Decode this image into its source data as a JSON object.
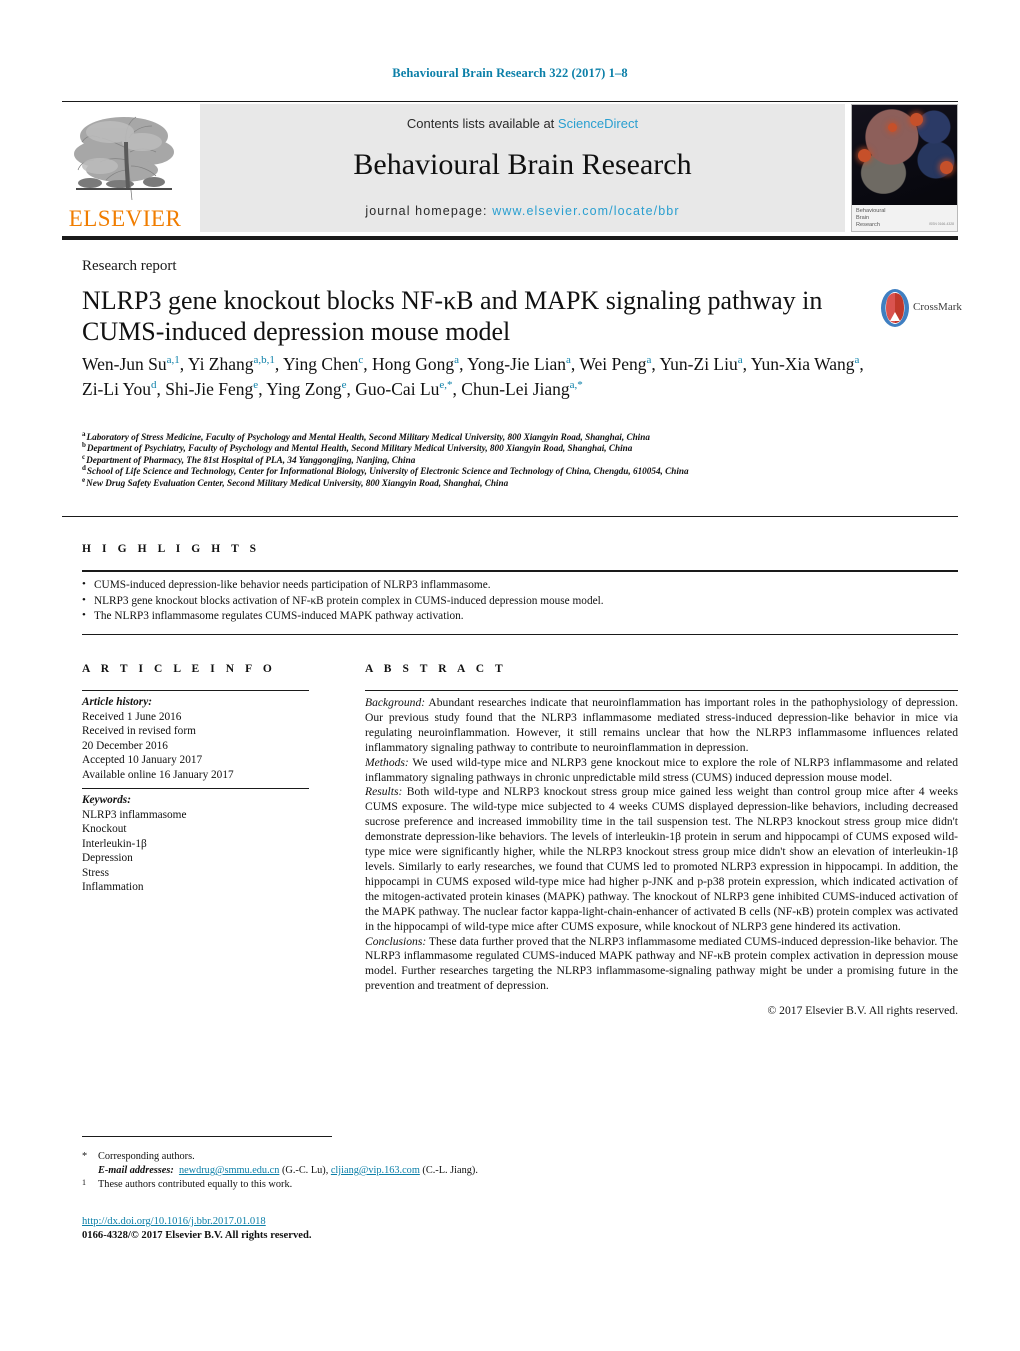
{
  "running_head": "Behavioural Brain Research 322 (2017) 1–8",
  "masthead": {
    "publisher_logo_text": "ELSEVIER",
    "contents_prefix": "Contents lists available at ",
    "contents_link": "ScienceDirect",
    "journal_title": "Behavioural Brain Research",
    "homepage_prefix": "journal homepage: ",
    "homepage_url": "www.elsevier.com/locate/bbr",
    "cover_caption_line1": "Behavioural",
    "cover_caption_line2": "Brain",
    "cover_caption_line3": "Research",
    "cover_issn": "ISSN 0166-4328"
  },
  "article": {
    "type": "Research report",
    "title_line1": "NLRP3 gene knockout blocks NF-κB and MAPK signaling pathway in",
    "title_line2": "CUMS-induced depression mouse model",
    "crossmark_label": "CrossMark"
  },
  "authors": [
    {
      "name": "Wen-Jun Su",
      "sup": "a,1",
      "sep": ", "
    },
    {
      "name": "Yi Zhang",
      "sup": "a,b,1",
      "sep": ", "
    },
    {
      "name": "Ying Chen",
      "sup": "c",
      "sep": ", "
    },
    {
      "name": "Hong Gong",
      "sup": "a",
      "sep": ", "
    },
    {
      "name": "Yong-Jie Lian",
      "sup": "a",
      "sep": ", "
    },
    {
      "name": "Wei Peng",
      "sup": "a",
      "sep": ", "
    },
    {
      "name": "Yun-Zi Liu",
      "sup": "a",
      "sep": ", "
    },
    {
      "name": "Yun-Xia Wang",
      "sup": "a",
      "sep": ", "
    },
    {
      "name": "Zi-Li You",
      "sup": "d",
      "sep": ", "
    },
    {
      "name": "Shi-Jie Feng",
      "sup": "e",
      "sep": ", "
    },
    {
      "name": "Ying Zong",
      "sup": "e",
      "sep": ", "
    },
    {
      "name": "Guo-Cai Lu",
      "sup": "e,*",
      "sep": ", "
    },
    {
      "name": "Chun-Lei Jiang",
      "sup": "a,*",
      "sep": ""
    }
  ],
  "affiliations": [
    {
      "marker": "a",
      "text": "Laboratory of Stress Medicine, Faculty of Psychology and Mental Health, Second Military Medical University, 800 Xiangyin Road, Shanghai, China"
    },
    {
      "marker": "b",
      "text": "Department of Psychiatry, Faculty of Psychology and Mental Health, Second Military Medical University, 800 Xiangyin Road, Shanghai, China"
    },
    {
      "marker": "c",
      "text": "Department of Pharmacy, The 81st Hospital of PLA, 34 Yanggongjing, Nanjing, China"
    },
    {
      "marker": "d",
      "text": "School of Life Science and Technology, Center for Informational Biology, University of Electronic Science and Technology of China, Chengdu, 610054, China"
    },
    {
      "marker": "e",
      "text": "New Drug Safety Evaluation Center, Second Military Medical University, 800 Xiangyin Road, Shanghai, China"
    }
  ],
  "highlights": {
    "label": "H I G H L I G H T S",
    "items": [
      "CUMS-induced depression-like behavior needs participation of NLRP3 inflammasome.",
      "NLRP3 gene knockout blocks activation of NF-κB protein complex in CUMS-induced depression mouse model.",
      "The NLRP3 inflammasome regulates CUMS-induced MAPK pathway activation."
    ]
  },
  "article_info": {
    "label": "A R T I C L E  I N F O",
    "history_heading": "Article history:",
    "history_lines": [
      "Received 1 June 2016",
      "Received in revised form",
      "20 December 2016",
      "Accepted 10 January 2017",
      "Available online 16 January 2017"
    ],
    "keywords_heading": "Keywords:",
    "keywords": [
      "NLRP3 inflammasome",
      "Knockout",
      "Interleukin-1β",
      "Depression",
      "Stress",
      "Inflammation"
    ]
  },
  "abstract": {
    "label": "A B S T R A C T",
    "background_lead": "Background:",
    "background_text": " Abundant researches indicate that neuroinflammation has important roles in the pathophysiology of depression. Our previous study found that the NLRP3 inflammasome mediated stress-induced depression-like behavior in mice via regulating neuroinflammation. However, it still remains unclear that how the NLRP3 inflammasome influences related inflammatory signaling pathway to contribute to neuroinflammation in depression.",
    "methods_lead": "Methods:",
    "methods_text": " We used wild-type mice and NLRP3 gene knockout mice to explore the role of NLRP3 inflammasome and related inflammatory signaling pathways in chronic unpredictable mild stress (CUMS) induced depression mouse model.",
    "results_lead": "Results:",
    "results_text": " Both wild-type and NLRP3 knockout stress group mice gained less weight than control group mice after 4 weeks CUMS exposure. The wild-type mice subjected to 4 weeks CUMS displayed depression-like behaviors, including decreased sucrose preference and increased immobility time in the tail suspension test. The NLRP3 knockout stress group mice didn't demonstrate depression-like behaviors. The levels of interleukin-1β protein in serum and hippocampi of CUMS exposed wild-type mice were significantly higher, while the NLRP3 knockout stress group mice didn't show an elevation of interleukin-1β levels. Similarly to early researches, we found that CUMS led to promoted NLRP3 expression in hippocampi. In addition, the hippocampi in CUMS exposed wild-type mice had higher p-JNK and p-p38 protein expression, which indicated activation of the mitogen-activated protein kinases (MAPK) pathway. The knockout of NLRP3 gene inhibited CUMS-induced activation of the MAPK pathway. The nuclear factor kappa-light-chain-enhancer of activated B cells (NF-κB) protein complex was activated in the hippocampi of wild-type mice after CUMS exposure, while knockout of NLRP3 gene hindered its activation.",
    "conclusions_lead": "Conclusions:",
    "conclusions_text": " These data further proved that the NLRP3 inflammasome mediated CUMS-induced depression-like behavior. The NLRP3 inflammasome regulated CUMS-induced MAPK pathway and NF-κB protein complex activation in depression mouse model. Further researches targeting the NLRP3 inflammasome-signaling pathway might be under a promising future in the prevention and treatment of depression.",
    "copyright": "© 2017 Elsevier B.V. All rights reserved."
  },
  "footnotes": {
    "corresponding_marker": "*",
    "corresponding_text": "Corresponding authors.",
    "email_label": "E-mail addresses:",
    "email_1": "newdrug@smmu.edu.cn",
    "email_1_attr": " (G.-C. Lu), ",
    "email_2": "cljiang@vip.163.com",
    "email_2_attr": " (C.-L. Jiang).",
    "equal_marker": "1",
    "equal_text": "These authors contributed equally to this work."
  },
  "footer": {
    "doi": "http://dx.doi.org/10.1016/j.bbr.2017.01.018",
    "issn_line": "0166-4328/© 2017 Elsevier B.V. All rights reserved."
  },
  "colors": {
    "link_blue": "#0b7fa8",
    "science_direct_blue": "#2a9fd0",
    "elsevier_orange": "#f07d00"
  }
}
